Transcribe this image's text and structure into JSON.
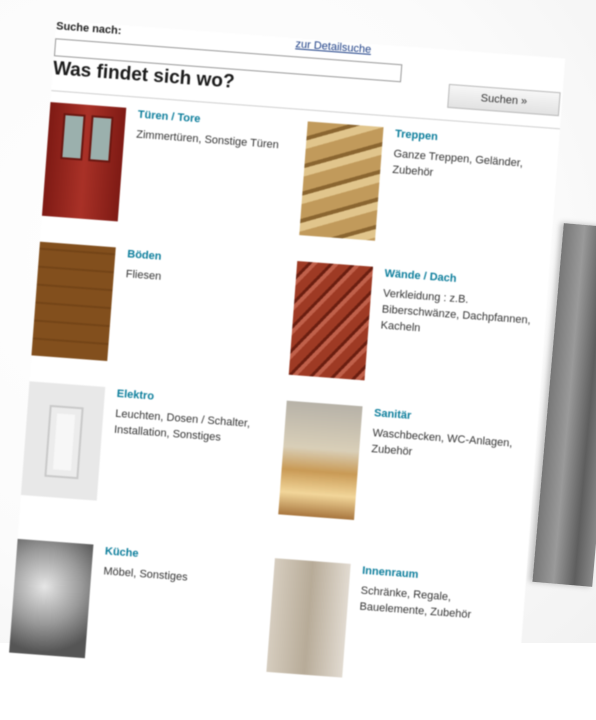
{
  "search": {
    "label": "Suche nach:",
    "detail_link": "zur Detailsuche",
    "button_label": "Suchen »",
    "input_value": "",
    "placeholder": ""
  },
  "heading": "Was findet sich wo?",
  "categories": [
    {
      "title": "Türen / Tore",
      "desc": "Zimmertüren, Sonstige Türen",
      "icon": "door-photo"
    },
    {
      "title": "Treppen",
      "desc": "Ganze Treppen, Geländer, Zubehör",
      "icon": "stairs-photo"
    },
    {
      "title": "Böden",
      "desc": "Fliesen",
      "icon": "floor-photo"
    },
    {
      "title": "Wände / Dach",
      "desc": "Verkleidung : z.B. Biberschwänze, Dachpfannen, Kacheln",
      "icon": "roof-tiles-photo"
    },
    {
      "title": "Elektro",
      "desc": "Leuchten, Dosen / Schalter, Installation, Sonstiges",
      "icon": "socket-photo"
    },
    {
      "title": "Sanitär",
      "desc": "Waschbecken, WC-Anlagen, Zubehör",
      "icon": "sanitary-photo"
    },
    {
      "title": "Küche",
      "desc": "Möbel, Sonstiges",
      "icon": "kitchen-photo"
    },
    {
      "title": "Innenraum",
      "desc": "Schränke, Regale, Bauelemente, Zubehör",
      "icon": "interior-photo"
    }
  ]
}
